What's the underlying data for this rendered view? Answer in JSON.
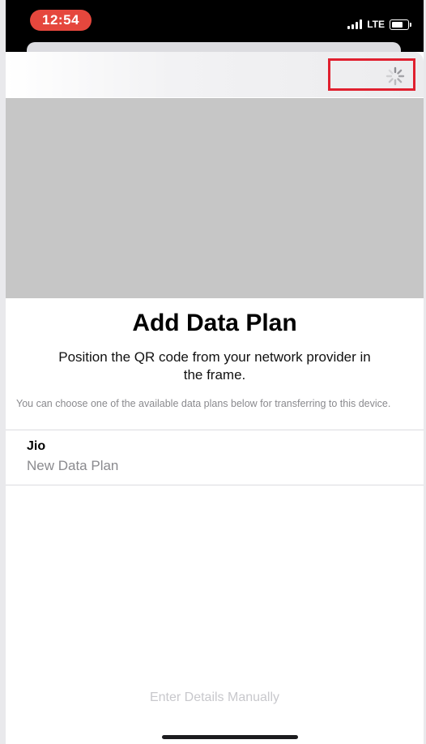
{
  "status_bar": {
    "time": "12:54",
    "network": "LTE",
    "colors": {
      "time_pill": "#e5473d",
      "background": "#000000"
    }
  },
  "nav": {
    "loading_icon": "spinner-icon",
    "highlight_color": "#e0202f"
  },
  "content": {
    "title": "Add Data Plan",
    "subtitle": "Position the QR code from your network provider in the frame.",
    "hint": "You can choose one of the available data plans below for transferring to this device."
  },
  "plans": [
    {
      "name": "Jio",
      "description": "New Data Plan"
    }
  ],
  "footer": {
    "manual_label": "Enter Details Manually"
  }
}
